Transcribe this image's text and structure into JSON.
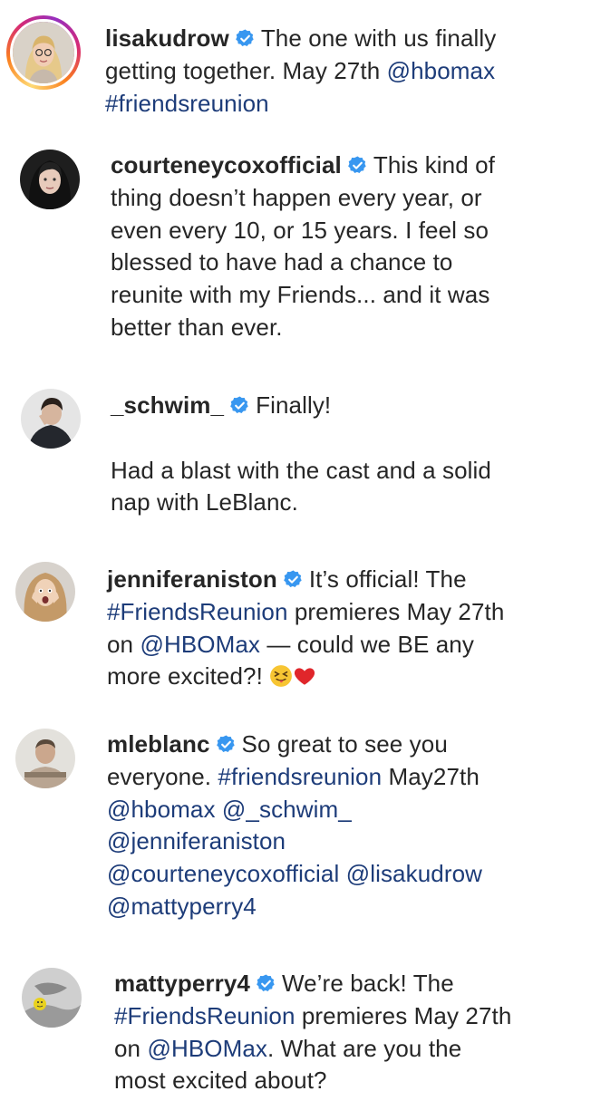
{
  "posts": [
    {
      "username": "lisakudrow",
      "lines": [
        [
          {
            "t": "text",
            "v": "The one with us finally"
          }
        ],
        [
          {
            "t": "text",
            "v": "getting together. May 27th "
          },
          {
            "t": "link",
            "v": "@hbomax"
          }
        ],
        [
          {
            "t": "link",
            "v": "#friendsreunion"
          }
        ]
      ]
    },
    {
      "username": "courteneycoxofficial",
      "lines": [
        [
          {
            "t": "text",
            "v": "This kind of"
          }
        ],
        [
          {
            "t": "text",
            "v": "thing doesn’t happen every year, or"
          }
        ],
        [
          {
            "t": "text",
            "v": "even every 10, or 15 years. I feel so"
          }
        ],
        [
          {
            "t": "text",
            "v": "blessed to have had a chance to"
          }
        ],
        [
          {
            "t": "text",
            "v": "reunite with my Friends... and it was"
          }
        ],
        [
          {
            "t": "text",
            "v": "better than ever."
          }
        ]
      ]
    },
    {
      "username": "_schwim_",
      "lines": [
        [
          {
            "t": "text",
            "v": "Finally!"
          }
        ],
        [
          {
            "t": "text",
            "v": ""
          }
        ],
        [
          {
            "t": "text",
            "v": "Had a blast with the cast and a solid"
          }
        ],
        [
          {
            "t": "text",
            "v": "nap with LeBlanc."
          }
        ]
      ]
    },
    {
      "username": "jenniferaniston",
      "lines": [
        [
          {
            "t": "text",
            "v": "It’s official! The"
          }
        ],
        [
          {
            "t": "link",
            "v": "#FriendsReunion"
          },
          {
            "t": "text",
            "v": " premieres May 27th"
          }
        ],
        [
          {
            "t": "text",
            "v": "on "
          },
          {
            "t": "link",
            "v": "@HBOMax"
          },
          {
            "t": "text",
            "v": " — could we BE any"
          }
        ],
        [
          {
            "t": "text",
            "v": "more excited?! "
          },
          {
            "t": "emoji",
            "v": "squinting-tongue-face"
          },
          {
            "t": "emoji",
            "v": "red-heart"
          }
        ]
      ]
    },
    {
      "username": "mleblanc",
      "lines": [
        [
          {
            "t": "text",
            "v": "So great to see you"
          }
        ],
        [
          {
            "t": "text",
            "v": "everyone. "
          },
          {
            "t": "link",
            "v": "#friendsreunion"
          },
          {
            "t": "text",
            "v": " May27th"
          }
        ],
        [
          {
            "t": "link",
            "v": "@hbomax"
          },
          {
            "t": "text",
            "v": " "
          },
          {
            "t": "link",
            "v": "@_schwim_"
          }
        ],
        [
          {
            "t": "link",
            "v": "@jenniferaniston"
          }
        ],
        [
          {
            "t": "link",
            "v": "@courteneycoxofficial"
          },
          {
            "t": "text",
            "v": " "
          },
          {
            "t": "link",
            "v": "@lisakudrow"
          }
        ],
        [
          {
            "t": "link",
            "v": "@mattyperry4"
          }
        ]
      ]
    },
    {
      "username": "mattyperry4",
      "lines": [
        [
          {
            "t": "text",
            "v": "We’re back! The"
          }
        ],
        [
          {
            "t": "link",
            "v": "#FriendsReunion"
          },
          {
            "t": "text",
            "v": " premieres May 27th"
          }
        ],
        [
          {
            "t": "text",
            "v": "on "
          },
          {
            "t": "link",
            "v": "@HBOMax"
          },
          {
            "t": "text",
            "v": ". What are you the"
          }
        ],
        [
          {
            "t": "text",
            "v": "most excited about?"
          }
        ]
      ]
    }
  ],
  "colors": {
    "text": "#262626",
    "link": "#1d3c79",
    "verified": "#3897f0"
  },
  "icons": {
    "verified": "verified-badge-icon"
  }
}
